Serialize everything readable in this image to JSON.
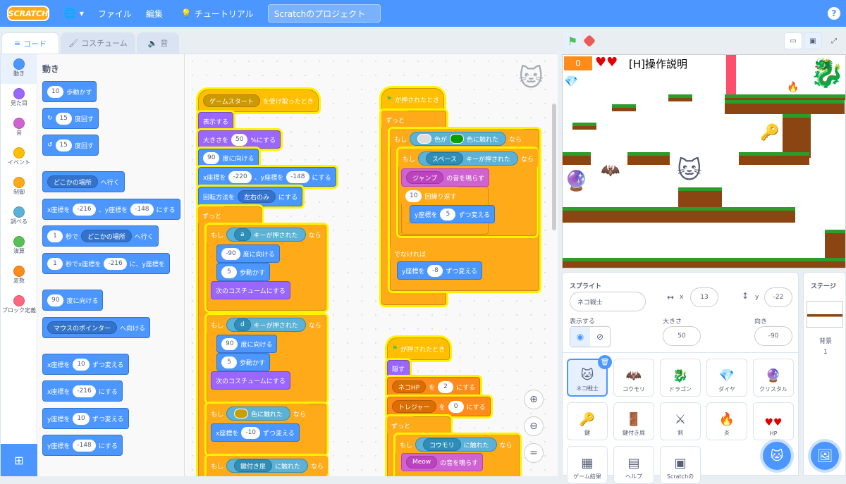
{
  "menu": {
    "logo": "SCRATCH",
    "file": "ファイル",
    "edit": "編集",
    "tutorial": "チュートリアル",
    "project_title": "Scratchのプロジェクト",
    "help": "?"
  },
  "tabs": {
    "code": "コード",
    "costume": "コスチューム",
    "sound": "音"
  },
  "categories": [
    {
      "label": "動き",
      "color": "#4c97ff"
    },
    {
      "label": "見た目",
      "color": "#9966ff"
    },
    {
      "label": "音",
      "color": "#cf63cf"
    },
    {
      "label": "イベント",
      "color": "#ffbf00"
    },
    {
      "label": "制御",
      "color": "#ffab19"
    },
    {
      "label": "調べる",
      "color": "#5cb1d6"
    },
    {
      "label": "演算",
      "color": "#59c059"
    },
    {
      "label": "変数",
      "color": "#ff8c1a"
    },
    {
      "label": "ブロック定義",
      "color": "#ff6680"
    }
  ],
  "palette": {
    "title": "動き",
    "move": {
      "n": "10",
      "t": "歩動かす"
    },
    "turn_r": {
      "n": "15",
      "t": "度回す"
    },
    "turn_l": {
      "n": "15",
      "t": "度回す"
    },
    "goto": {
      "dd": "どこかの場所",
      "t": "へ行く"
    },
    "gotoxy": {
      "a": "x座標を",
      "x": "-216",
      "b": "、y座標を",
      "y": "-148",
      "c": "にする"
    },
    "glide": {
      "n": "1",
      "a": "秒で",
      "dd": "どこかの場所",
      "b": "へ行く"
    },
    "glidexy": {
      "n": "1",
      "a": "秒でx座標を",
      "x": "-216",
      "b": "に、y座標を"
    },
    "point": {
      "n": "90",
      "t": "度に向ける"
    },
    "pointto": {
      "dd": "マウスのポインター",
      "t": "へ向ける"
    },
    "chx": {
      "a": "x座標を",
      "n": "10",
      "b": "ずつ変える"
    },
    "setx": {
      "a": "x座標を",
      "n": "-216",
      "b": "にする"
    },
    "chy": {
      "a": "y座標を",
      "n": "10",
      "b": "ずつ変える"
    },
    "sety": {
      "a": "y座標を",
      "n": "-148",
      "b": "にする"
    }
  },
  "script1": {
    "hat_dd": "ゲームスタート",
    "hat_t": "を受け取ったとき",
    "show": "表示する",
    "size_a": "大きさを",
    "size_n": "50",
    "size_b": "%にする",
    "dir_n": "90",
    "dir_t": "度に向ける",
    "xy_a": "x座標を",
    "xy_x": "-220",
    "xy_b": "、y座標を",
    "xy_y": "-148",
    "xy_c": "にする",
    "rot_a": "回転方法を",
    "rot_dd": "左右のみ",
    "rot_b": "にする",
    "forever": "ずっと",
    "if1": "もし",
    "if1_key": "a",
    "if1_t": "キーが押された",
    "then": "なら",
    "a_dir": "-90",
    "a_dir_t": "度に向ける",
    "a_move": "5",
    "a_move_t": "歩動かす",
    "a_cost": "次のコスチュームにする",
    "if2_key": "d",
    "b_dir": "90",
    "b_dir_t": "度に向ける",
    "b_move": "5",
    "b_move_t": "歩動かす",
    "b_cost": "次のコスチュームにする",
    "if3_t": "色に触れた",
    "setx_a": "x座標を",
    "setx_n": "-10",
    "setx_b": "ずつ変える",
    "if4_dd": "鍵付き扉",
    "if4_t": "に触れた"
  },
  "script2": {
    "hat": "が押されたとき",
    "forever": "ずっと",
    "if": "もし",
    "color_t1": "色が",
    "color_t2": "色に触れた",
    "then": "なら",
    "if_key": "スペース",
    "if_key_t": "キーが押された",
    "snd_dd": "ジャンプ",
    "snd_t": "の音を鳴らす",
    "rep_n": "10",
    "rep_t": "回繰り返す",
    "chy_a": "y座標を",
    "chy_n": "5",
    "chy_b": "ずつ変える",
    "else": "でなければ",
    "chy2_a": "y座標を",
    "chy2_n": "-8",
    "chy2_b": "ずつ変える"
  },
  "script3": {
    "hat": "が押されたとき",
    "hide": "隠す",
    "v1_dd": "ネコHP",
    "v1_a": "を",
    "v1_n": "2",
    "v1_b": "にする",
    "v2_dd": "トレジャー",
    "v2_a": "を",
    "v2_n": "0",
    "v2_b": "にする",
    "forever": "ずっと",
    "if": "もし",
    "if_dd": "コウモリ",
    "if_t": "に触れた",
    "then": "なら",
    "snd_dd": "Meow",
    "snd_t": "の音を鳴らす"
  },
  "stage": {
    "score": "0",
    "hearts": "♥♥",
    "instruction": "[H]操作説明"
  },
  "sprite_info": {
    "label": "スプライト",
    "name": "ネコ戦士",
    "x_label": "x",
    "x": "13",
    "y_label": "y",
    "y": "-22",
    "show_label": "表示する",
    "size_label": "大きさ",
    "size": "50",
    "dir_label": "向き",
    "dir": "-90"
  },
  "sprites": [
    {
      "name": "ネコ戦士",
      "icon": "🐱"
    },
    {
      "name": "コウモリ",
      "icon": "🦇"
    },
    {
      "name": "ドラゴン",
      "icon": "🐉"
    },
    {
      "name": "ダイヤ",
      "icon": "💎"
    },
    {
      "name": "クリスタル",
      "icon": "🔮"
    },
    {
      "name": "鍵",
      "icon": "🔑"
    },
    {
      "name": "鍵付き扉",
      "icon": "🚪"
    },
    {
      "name": "剣",
      "icon": "⚔"
    },
    {
      "name": "炎",
      "icon": "🔥"
    },
    {
      "name": "HP",
      "icon": "♥♥"
    },
    {
      "name": "ゲーム結果",
      "icon": "▦"
    },
    {
      "name": "ヘルプ",
      "icon": "▤"
    },
    {
      "name": "Scratchの",
      "icon": "▣"
    }
  ],
  "stage_pane": {
    "title": "ステージ",
    "backdrop_label": "背景",
    "backdrop_count": "1"
  }
}
